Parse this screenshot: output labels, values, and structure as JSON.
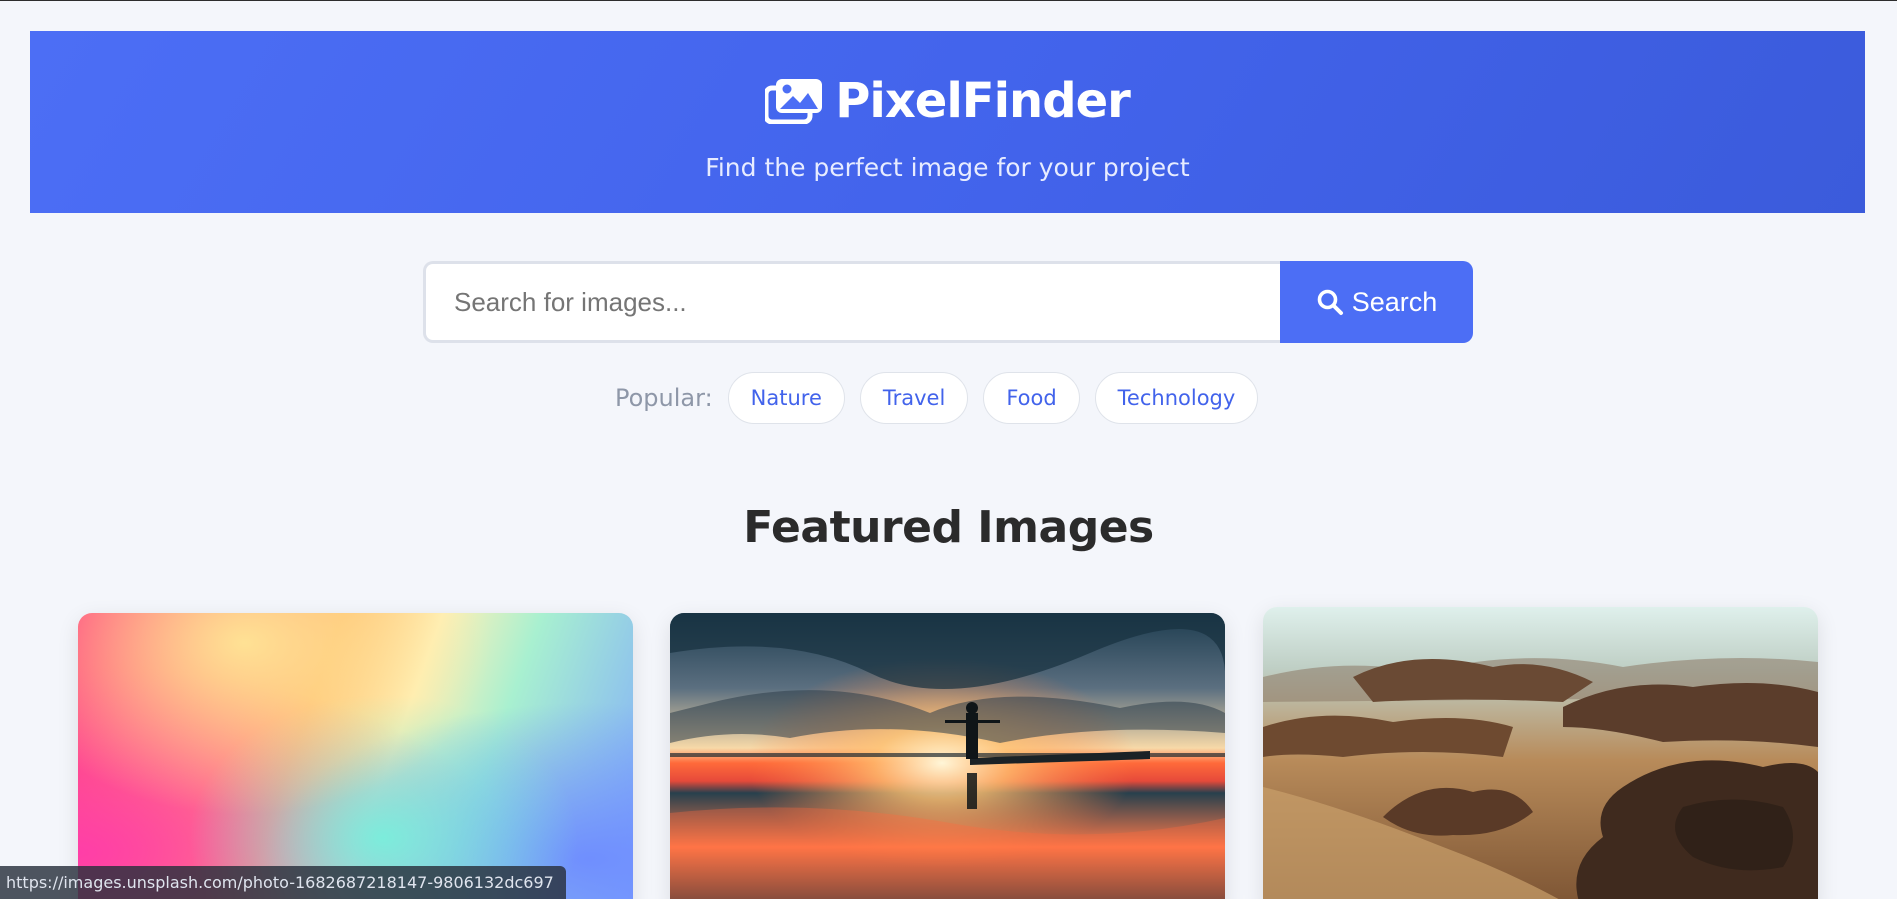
{
  "header": {
    "brand_name": "PixelFinder",
    "brand_icon": "images-icon",
    "tagline": "Find the perfect image for your project",
    "gradient_colors": [
      "#4c6ef5",
      "#3b5bdb"
    ]
  },
  "search": {
    "placeholder": "Search for images...",
    "value": "",
    "button_label": "Search",
    "button_icon": "search-icon",
    "accent_color": "#4c6ef5"
  },
  "popular": {
    "label": "Popular:",
    "tags": [
      "Nature",
      "Travel",
      "Food",
      "Technology"
    ]
  },
  "featured": {
    "title": "Featured Images",
    "cards": [
      {
        "description_icon": "abstract-gradient-image"
      },
      {
        "description_icon": "sunset-silhouette-image"
      },
      {
        "description_icon": "desert-rocks-image"
      }
    ]
  },
  "status_bar": {
    "url": "https://images.unsplash.com/photo-1682687218147-9806132dc697"
  }
}
